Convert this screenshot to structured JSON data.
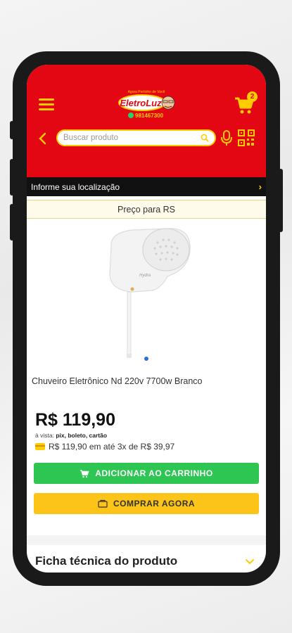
{
  "header": {
    "logo_tagline": "Agora Pertinho de Você",
    "logo_name": "EletroLuz",
    "logo_phone": "981467300",
    "cart_count": "2",
    "accent": "#e30613",
    "highlight": "#ffcc00"
  },
  "search": {
    "placeholder": "Buscar produto"
  },
  "location": {
    "label": "Informe sua localização",
    "chevron": "›"
  },
  "price_for": {
    "label": "Preço para RS"
  },
  "product": {
    "name": "Chuveiro Eletrônico Nd 220v 7700w Branco",
    "price": "R$ 119,90",
    "payment_prefix": "à vista:",
    "payment_methods": "pix, boleto, cartão",
    "installments": "R$ 119,90 em até 3x de R$ 39,97",
    "image_brand": "Hydra"
  },
  "buttons": {
    "add_to_cart": "ADICIONAR AO CARRINHO",
    "buy_now": "COMPRAR AGORA"
  },
  "specs": {
    "title": "Ficha técnica do produto",
    "icon": "chevron-down-icon"
  }
}
